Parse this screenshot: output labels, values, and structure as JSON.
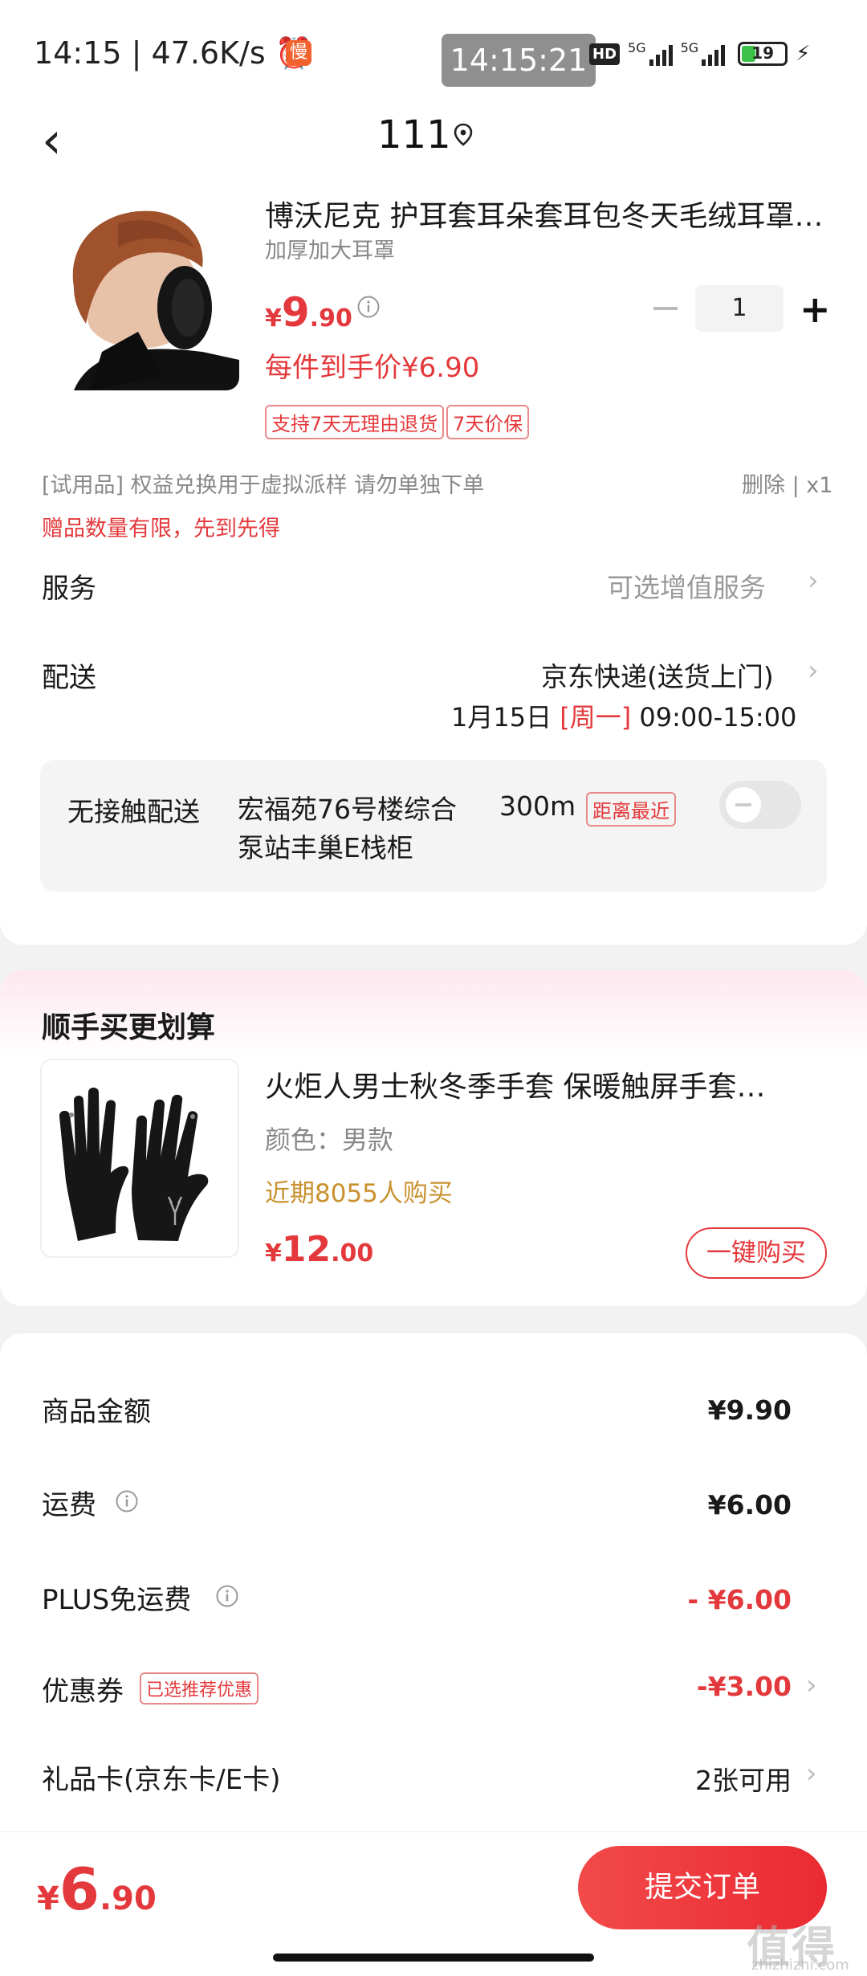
{
  "status_bar": {
    "clock": "14:15",
    "speed": "47.6K/s",
    "app_badge": "慢",
    "center_time": "14:15:21",
    "hd": "HD",
    "net1": "5G",
    "net2": "5G",
    "battery": "19"
  },
  "header": {
    "back_glyph": "‹",
    "title": "111"
  },
  "product": {
    "title": "博沃尼克 护耳套耳朵套耳包冬天毛绒耳罩…",
    "subtitle": "加厚加大耳罩",
    "price_symbol": "¥",
    "price_int": "9",
    "price_dec": ".90",
    "quantity": "1",
    "deal_price": "每件到手价¥6.90",
    "tags": [
      "支持7天无理由退货",
      "7天价保"
    ]
  },
  "gift": {
    "line": "[试用品]   权益兑换用于虚拟派样 请勿单独下单",
    "actions": "删除 | x1",
    "warning": "赠品数量有限，先到先得"
  },
  "service": {
    "label": "服务",
    "value": "可选增值服务",
    "chevron": "›"
  },
  "delivery": {
    "label": "配送",
    "value": "京东快递(送货上门)",
    "chevron": "›",
    "date": "1月15日",
    "weekday": "[周一]",
    "window": "09:00-15:00"
  },
  "contactless": {
    "label": "无接触配送",
    "address": "宏福苑76号楼综合泵站丰巢E栈柜",
    "distance": "300m",
    "tag": "距离最近",
    "toggle_on": false
  },
  "upsell": {
    "section_title": "顺手买更划算",
    "title": "火炬人男士秋冬季手套 保暖触屏手套…",
    "color": "颜色：男款",
    "buyers": "近期8055人购买",
    "price_symbol": "¥",
    "price_int": "12",
    "price_dec": ".00",
    "button": "一键购买"
  },
  "summary": {
    "goods_label": "商品金额",
    "goods_value": "¥9.90",
    "shipping_label": "运费",
    "shipping_value": "¥6.00",
    "plus_label": "PLUS免运费",
    "plus_value": "- ¥6.00",
    "coupon_label": "优惠券",
    "coupon_tag": "已选推荐优惠",
    "coupon_value": "-¥3.00",
    "giftcard_label": "礼品卡(京东卡/E卡)",
    "giftcard_value": "2张可用",
    "chevron": "›"
  },
  "bottom": {
    "total_symbol": "¥",
    "total_int": "6",
    "total_dec": ".90",
    "submit": "提交订单"
  },
  "watermark": {
    "text": "值得值",
    "sub": "zhizhizhi.com"
  },
  "colors": {
    "accent_red": "#e4393c",
    "buyers_gold": "#c9912f"
  }
}
